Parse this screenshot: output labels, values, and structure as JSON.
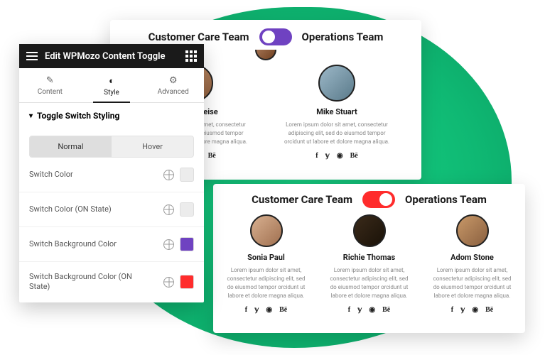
{
  "editor": {
    "title": "Edit WPMozo Content Toggle",
    "tabs": {
      "content": "Content",
      "style": "Style",
      "advanced": "Advanced"
    },
    "section_title": "Toggle Switch Styling",
    "states": {
      "normal": "Normal",
      "hover": "Hover"
    },
    "controls": {
      "switch_color": "Switch Color",
      "switch_color_on": "Switch Color (ON State)",
      "switch_bg": "Switch Background Color",
      "switch_bg_on": "Switch Background Color (ON State)"
    }
  },
  "preview": {
    "left_title": "Customer Care Team",
    "right_title": "Operations Team",
    "lorem": "Lorem ipsum dolor sit amet, consectetur adipiscing elit, sed do eiusmod tempor orcidunt ut labore et dolore magna aliqua.",
    "top_members": [
      {
        "name": "Adam Cheise"
      },
      {
        "name": "Mike Stuart"
      }
    ],
    "bottom_members": [
      {
        "name": "Sonia Paul"
      },
      {
        "name": "Richie Thomas"
      },
      {
        "name": "Adom Stone"
      }
    ],
    "socials": [
      "f",
      "y",
      "dr",
      "Be"
    ]
  }
}
